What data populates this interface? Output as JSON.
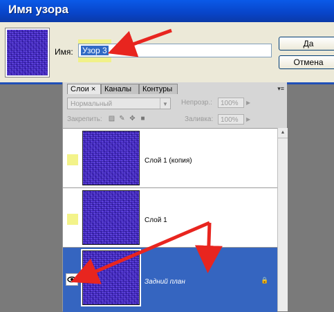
{
  "dialog": {
    "title": "Имя узора",
    "name_label": "Имя:",
    "name_value": "Узор 3",
    "ok_label": "Да",
    "cancel_label": "Отмена"
  },
  "panel": {
    "tabs": [
      {
        "label": "Слои",
        "close": "×",
        "active": true
      },
      {
        "label": "Каналы",
        "active": false
      },
      {
        "label": "Контуры",
        "active": false
      }
    ],
    "blend_mode": "Нормальный",
    "opacity_label": "Непрозр.:",
    "opacity_value": "100%",
    "lock_label": "Закрепить:",
    "fill_label": "Заливка:",
    "fill_value": "100%",
    "layers": [
      {
        "name": "Слой 1 (копия)",
        "visible": false,
        "selected": false
      },
      {
        "name": "Слой 1",
        "visible": false,
        "selected": false
      },
      {
        "name": "Задний план",
        "visible": true,
        "selected": true,
        "locked": true
      }
    ]
  },
  "colors": {
    "accent": "#3565c0",
    "annotation_arrow": "#e8251f",
    "highlight": "#f2f27a",
    "pattern": "#5033d0"
  }
}
